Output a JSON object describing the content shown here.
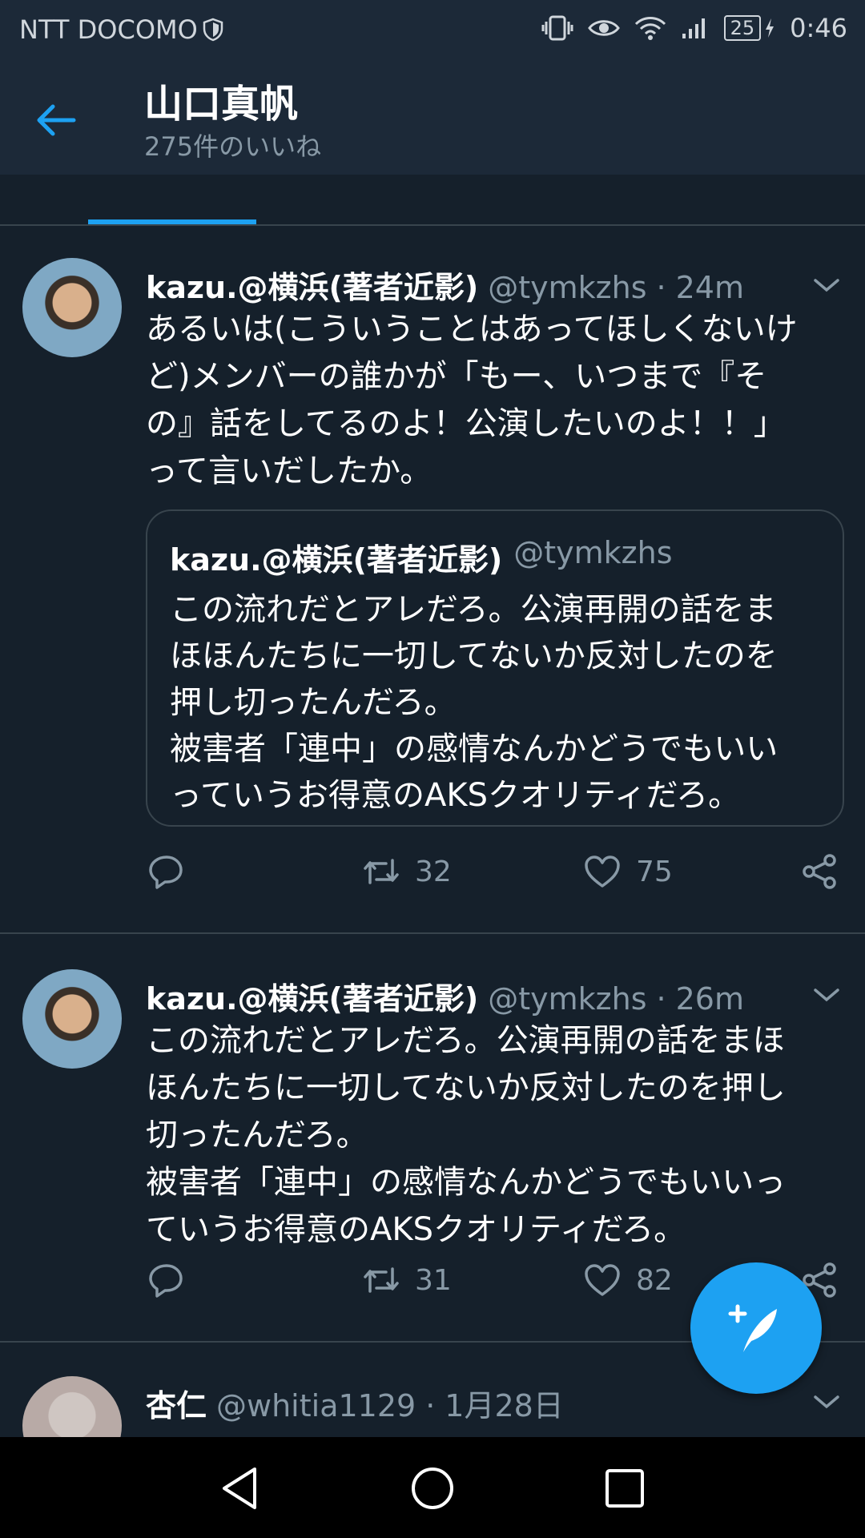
{
  "status_bar": {
    "carrier": "NTT DOCOMO",
    "battery": "25",
    "time": "0:46",
    "icons": [
      "shield-icon",
      "vibrate-icon",
      "eye-icon",
      "wifi-icon",
      "signal-icon",
      "battery-icon",
      "charging-icon"
    ]
  },
  "header": {
    "title": "山口真帆",
    "subtitle": "275件のいいね"
  },
  "tweets": [
    {
      "name": "kazu.@横浜(著者近影)",
      "handle": "@tymkzhs",
      "dot": "·",
      "time": "24m",
      "text": "あるいは(こういうことはあってほしくないけ\nど)メンバーの誰かが「もー、いつまで『そ\nの』話をしてるのよ！公演したいのよ！！」\nって言いだしたか。",
      "quote": {
        "name": "kazu.@横浜(著者近影)",
        "handle": "@tymkzhs",
        "text": "この流れだとアレだろ。公演再開の話をま\nほほんたちに一切してないか反対したのを\n押し切ったんだろ。\n被害者「連中」の感情なんかどうでもいい\nっていうお得意のAKSクオリティだろ。"
      },
      "retweets": "32",
      "likes": "75"
    },
    {
      "name": "kazu.@横浜(著者近影)",
      "handle": "@tymkzhs",
      "dot": "·",
      "time": "26m",
      "text": "この流れだとアレだろ。公演再開の話をまほ\nほんたちに一切してないか反対したのを押し\n切ったんだろ。\n被害者「連中」の感情なんかどうでもいいっ\nていうお得意のAKSクオリティだろ。",
      "retweets": "31",
      "likes": "82"
    },
    {
      "name": "杏仁",
      "handle": "@whitia1129",
      "dot": "·",
      "time": "1月28日"
    }
  ],
  "colors": {
    "background": "#15202b",
    "header": "#1c2938",
    "accent": "#1da1f2",
    "secondary_text": "#8899a6",
    "divider": "#38444d"
  }
}
